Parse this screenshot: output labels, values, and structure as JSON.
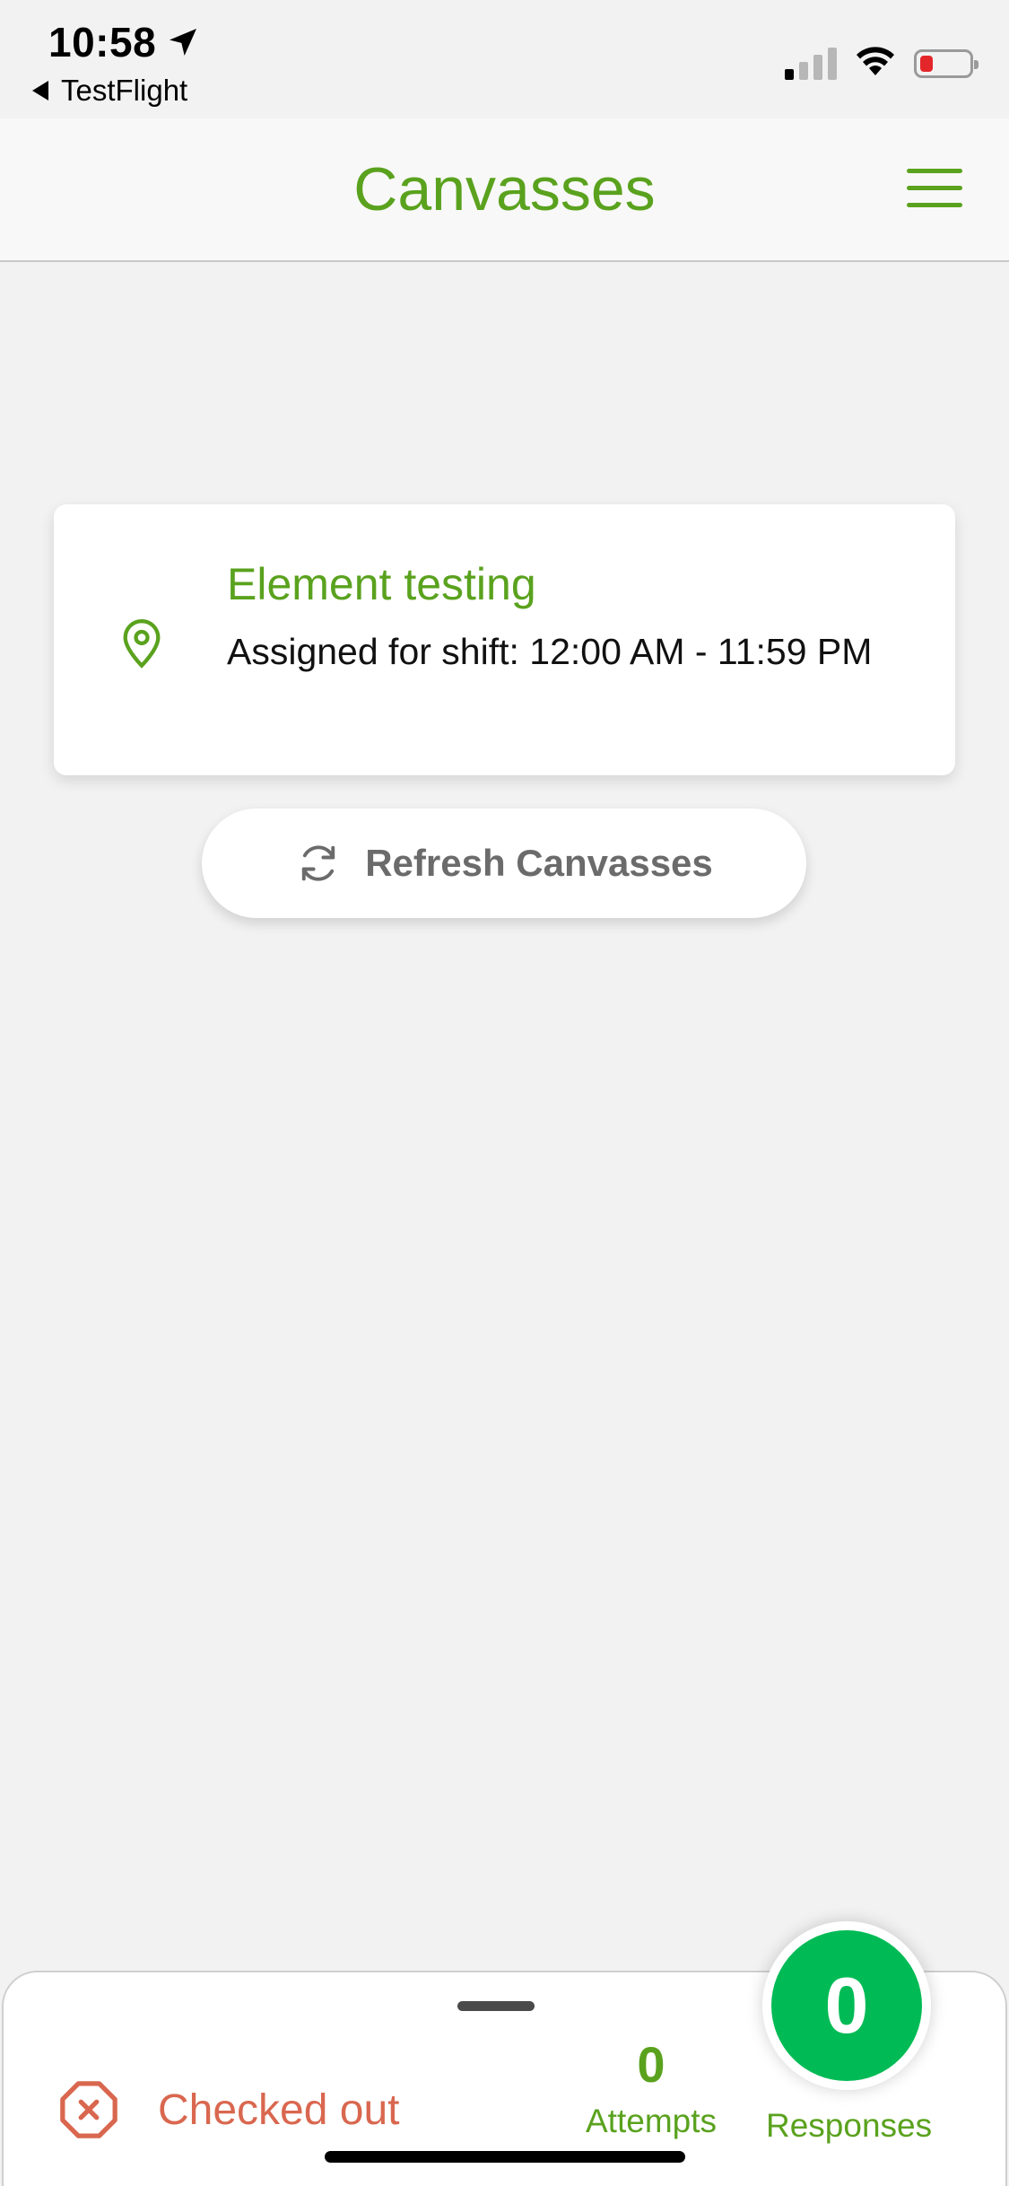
{
  "status_bar": {
    "time": "10:58",
    "back_app": "TestFlight",
    "battery_color": "#e3262a"
  },
  "header": {
    "title": "Canvasses",
    "menu_icon": "hamburger-menu-icon",
    "accent_color": "#5aa21e"
  },
  "canvass": {
    "title": "Element testing",
    "subtitle": "Assigned for shift: 12:00 AM - 11:59 PM",
    "icon": "location-pin-icon"
  },
  "refresh": {
    "label": "Refresh Canvasses",
    "icon": "refresh-icon"
  },
  "bottom_panel": {
    "status_label": "Checked out",
    "status_color": "#d9674f",
    "attempts_count": "0",
    "attempts_label": "Attempts",
    "responses_count": "0",
    "responses_label": "Responses",
    "responses_color": "#00bb55"
  }
}
